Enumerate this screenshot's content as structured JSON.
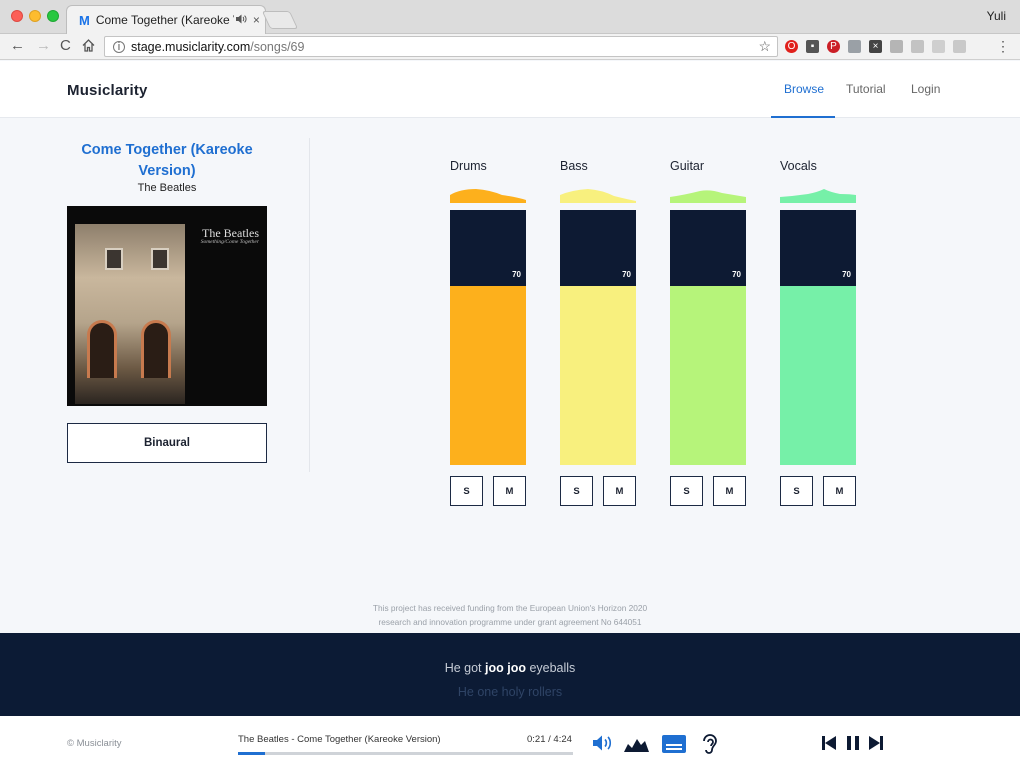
{
  "browser": {
    "tab_title": "Come Together (Kareoke Ve",
    "tab_favicon": "M",
    "tab_audio_icon": "speaker-icon",
    "tab_close": "×",
    "profile_name": "Yuli",
    "url_host": "stage.musiclarity.com",
    "url_path": "/songs/69"
  },
  "header": {
    "brand": "Musiclarity",
    "nav": {
      "browse": "Browse",
      "tutorial": "Tutorial",
      "login": "Login"
    },
    "active_nav": "Browse"
  },
  "song": {
    "title": "Come Together (Kareoke Version)",
    "artist": "The Beatles",
    "cover_text_band": "The Beatles",
    "cover_text_subtitle": "Something/Come Together",
    "mode_button": "Binaural"
  },
  "tracks": [
    {
      "name": "Drums",
      "volume": "70",
      "color": "#fdb01c",
      "solo_label": "S",
      "mute_label": "M"
    },
    {
      "name": "Bass",
      "volume": "70",
      "color": "#f8f07e",
      "solo_label": "S",
      "mute_label": "M"
    },
    {
      "name": "Guitar",
      "volume": "70",
      "color": "#b6f47a",
      "solo_label": "S",
      "mute_label": "M"
    },
    {
      "name": "Vocals",
      "volume": "70",
      "color": "#76f0a8",
      "solo_label": "S",
      "mute_label": "M"
    }
  ],
  "funding": {
    "line1": "This project has received funding from the European Union's Horizon 2020",
    "line2": "research and innovation programme under grant agreement No 644051"
  },
  "lyrics": {
    "current_pre": "He got ",
    "current_bold": "joo joo",
    "current_post": " eyeballs",
    "next": "He one holy rollers"
  },
  "player": {
    "copyright": "© Musiclarity",
    "now_playing": "The Beatles - Come Together (Kareoke Version)",
    "time": "0:21 / 4:24",
    "progress_fraction": 0.08,
    "icons": [
      "volume-icon",
      "waveform-icon",
      "lyrics-icon",
      "ear-icon"
    ],
    "transport": [
      "previous-icon",
      "pause-icon",
      "next-icon"
    ]
  },
  "colors": {
    "accent": "#1f6fd1",
    "navy": "#0d1a33"
  }
}
